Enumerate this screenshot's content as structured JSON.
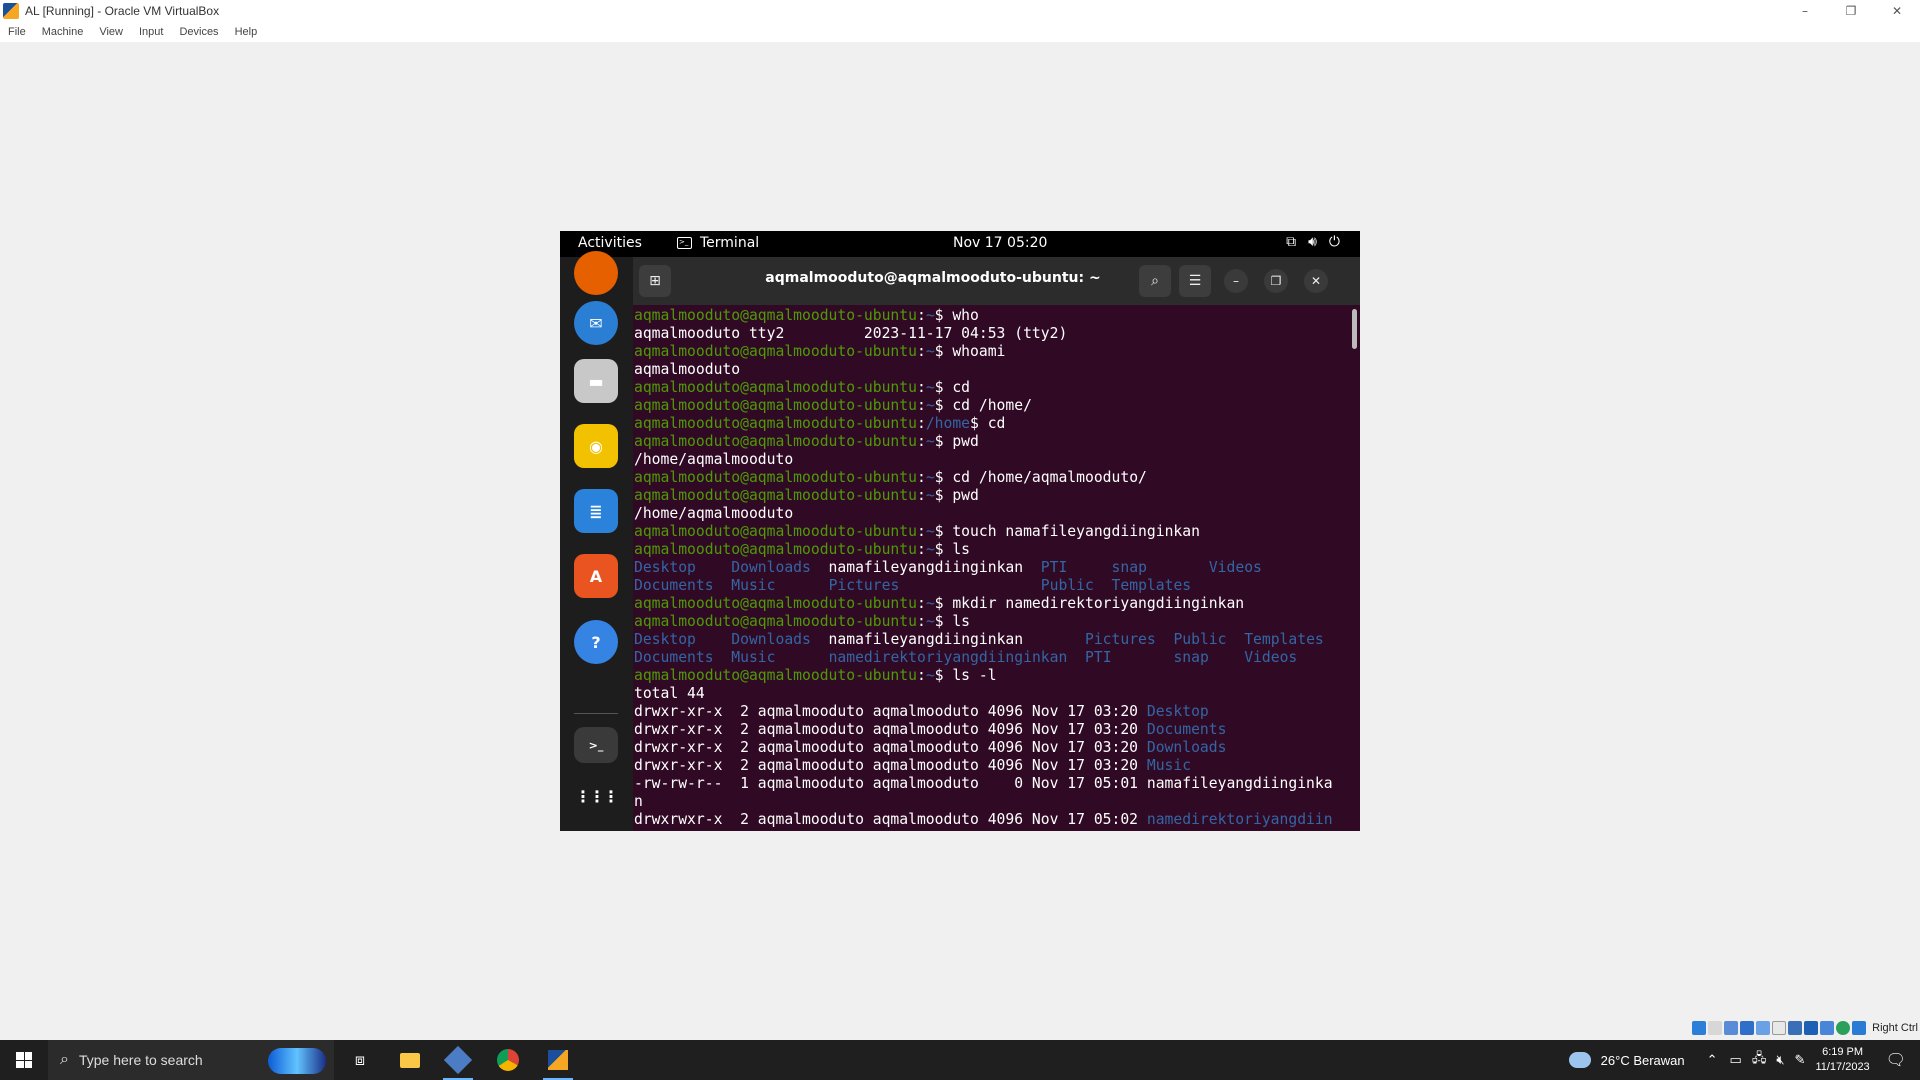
{
  "host": {
    "title": "AL [Running] - Oracle VM VirtualBox",
    "controls": [
      "–",
      "❐",
      "✕"
    ],
    "menu": [
      "File",
      "Machine",
      "View",
      "Input",
      "Devices",
      "Help"
    ]
  },
  "gnome": {
    "activities": "Activities",
    "app_name": "Terminal",
    "clock": "Nov 17  05:20"
  },
  "terminal": {
    "title": "aqmalmooduto@aqmalmooduto-ubuntu: ~",
    "lines": [
      [
        [
          "u",
          "aqmalmooduto@aqmalmooduto-ubuntu"
        ],
        [
          "t",
          ":"
        ],
        [
          "p",
          "~"
        ],
        [
          "t",
          "$ who"
        ]
      ],
      [
        [
          "t",
          "aqmalmooduto tty2         2023-11-17 04:53 (tty2)"
        ]
      ],
      [
        [
          "u",
          "aqmalmooduto@aqmalmooduto-ubuntu"
        ],
        [
          "t",
          ":"
        ],
        [
          "p",
          "~"
        ],
        [
          "t",
          "$ whoami"
        ]
      ],
      [
        [
          "t",
          "aqmalmooduto"
        ]
      ],
      [
        [
          "u",
          "aqmalmooduto@aqmalmooduto-ubuntu"
        ],
        [
          "t",
          ":"
        ],
        [
          "p",
          "~"
        ],
        [
          "t",
          "$ cd"
        ]
      ],
      [
        [
          "u",
          "aqmalmooduto@aqmalmooduto-ubuntu"
        ],
        [
          "t",
          ":"
        ],
        [
          "p",
          "~"
        ],
        [
          "t",
          "$ cd /home/"
        ]
      ],
      [
        [
          "u",
          "aqmalmooduto@aqmalmooduto-ubuntu"
        ],
        [
          "t",
          ":"
        ],
        [
          "p",
          "/home"
        ],
        [
          "t",
          "$ cd"
        ]
      ],
      [
        [
          "u",
          "aqmalmooduto@aqmalmooduto-ubuntu"
        ],
        [
          "t",
          ":"
        ],
        [
          "p",
          "~"
        ],
        [
          "t",
          "$ pwd"
        ]
      ],
      [
        [
          "t",
          "/home/aqmalmooduto"
        ]
      ],
      [
        [
          "u",
          "aqmalmooduto@aqmalmooduto-ubuntu"
        ],
        [
          "t",
          ":"
        ],
        [
          "p",
          "~"
        ],
        [
          "t",
          "$ cd /home/aqmalmooduto/"
        ]
      ],
      [
        [
          "u",
          "aqmalmooduto@aqmalmooduto-ubuntu"
        ],
        [
          "t",
          ":"
        ],
        [
          "p",
          "~"
        ],
        [
          "t",
          "$ pwd"
        ]
      ],
      [
        [
          "t",
          "/home/aqmalmooduto"
        ]
      ],
      [
        [
          "u",
          "aqmalmooduto@aqmalmooduto-ubuntu"
        ],
        [
          "t",
          ":"
        ],
        [
          "p",
          "~"
        ],
        [
          "t",
          "$ touch namafileyangdiinginkan"
        ]
      ],
      [
        [
          "u",
          "aqmalmooduto@aqmalmooduto-ubuntu"
        ],
        [
          "t",
          ":"
        ],
        [
          "p",
          "~"
        ],
        [
          "t",
          "$ ls"
        ]
      ],
      [
        [
          "d",
          "Desktop"
        ],
        [
          "t",
          "    "
        ],
        [
          "d",
          "Downloads"
        ],
        [
          "t",
          "  namafileyangdiinginkan  "
        ],
        [
          "d",
          "PTI"
        ],
        [
          "t",
          "     "
        ],
        [
          "d",
          "snap"
        ],
        [
          "t",
          "       "
        ],
        [
          "d",
          "Videos"
        ]
      ],
      [
        [
          "d",
          "Documents"
        ],
        [
          "t",
          "  "
        ],
        [
          "d",
          "Music"
        ],
        [
          "t",
          "      "
        ],
        [
          "d",
          "Pictures"
        ],
        [
          "t",
          "                "
        ],
        [
          "d",
          "Public"
        ],
        [
          "t",
          "  "
        ],
        [
          "d",
          "Templates"
        ]
      ],
      [
        [
          "u",
          "aqmalmooduto@aqmalmooduto-ubuntu"
        ],
        [
          "t",
          ":"
        ],
        [
          "p",
          "~"
        ],
        [
          "t",
          "$ mkdir namedirektoriyangdiinginkan"
        ]
      ],
      [
        [
          "u",
          "aqmalmooduto@aqmalmooduto-ubuntu"
        ],
        [
          "t",
          ":"
        ],
        [
          "p",
          "~"
        ],
        [
          "t",
          "$ ls"
        ]
      ],
      [
        [
          "d",
          "Desktop"
        ],
        [
          "t",
          "    "
        ],
        [
          "d",
          "Downloads"
        ],
        [
          "t",
          "  namafileyangdiinginkan       "
        ],
        [
          "d",
          "Pictures"
        ],
        [
          "t",
          "  "
        ],
        [
          "d",
          "Public"
        ],
        [
          "t",
          "  "
        ],
        [
          "d",
          "Templates"
        ]
      ],
      [
        [
          "d",
          "Documents"
        ],
        [
          "t",
          "  "
        ],
        [
          "d",
          "Music"
        ],
        [
          "t",
          "      "
        ],
        [
          "d",
          "namedirektoriyangdiinginkan"
        ],
        [
          "t",
          "  "
        ],
        [
          "d",
          "PTI"
        ],
        [
          "t",
          "       "
        ],
        [
          "d",
          "snap"
        ],
        [
          "t",
          "    "
        ],
        [
          "d",
          "Videos"
        ]
      ],
      [
        [
          "u",
          "aqmalmooduto@aqmalmooduto-ubuntu"
        ],
        [
          "t",
          ":"
        ],
        [
          "p",
          "~"
        ],
        [
          "t",
          "$ ls -l"
        ]
      ],
      [
        [
          "t",
          "total 44"
        ]
      ],
      [
        [
          "t",
          "drwxr-xr-x  2 aqmalmooduto aqmalmooduto 4096 Nov 17 03:20 "
        ],
        [
          "d",
          "Desktop"
        ]
      ],
      [
        [
          "t",
          "drwxr-xr-x  2 aqmalmooduto aqmalmooduto 4096 Nov 17 03:20 "
        ],
        [
          "d",
          "Documents"
        ]
      ],
      [
        [
          "t",
          "drwxr-xr-x  2 aqmalmooduto aqmalmooduto 4096 Nov 17 03:20 "
        ],
        [
          "d",
          "Downloads"
        ]
      ],
      [
        [
          "t",
          "drwxr-xr-x  2 aqmalmooduto aqmalmooduto 4096 Nov 17 03:20 "
        ],
        [
          "d",
          "Music"
        ]
      ],
      [
        [
          "t",
          "-rw-rw-r--  1 aqmalmooduto aqmalmooduto    0 Nov 17 05:01 namafileyangdiinginka"
        ]
      ],
      [
        [
          "t",
          "n"
        ]
      ],
      [
        [
          "t",
          "drwxrwxr-x  2 aqmalmooduto aqmalmooduto 4096 Nov 17 05:02 "
        ],
        [
          "d",
          "namedirektoriyangdiin"
        ]
      ]
    ]
  },
  "dock": [
    {
      "name": "firefox-icon",
      "color": "#e66000",
      "glyph": ""
    },
    {
      "name": "thunderbird-icon",
      "color": "#2a7fd4",
      "glyph": "✉"
    },
    {
      "name": "files-icon",
      "color": "#c8c8c8",
      "glyph": "▬"
    },
    {
      "name": "rhythmbox-icon",
      "color": "#f2c200",
      "glyph": "◉"
    },
    {
      "name": "writer-icon",
      "color": "#2a82da",
      "glyph": "≣"
    },
    {
      "name": "software-icon",
      "color": "#e95420",
      "glyph": "A"
    },
    {
      "name": "help-icon",
      "color": "#3584e4",
      "glyph": "?"
    },
    {
      "name": "terminal-icon",
      "color": "#3a3a3a",
      "glyph": ">_"
    },
    {
      "name": "apps-grid-icon",
      "color": "transparent",
      "glyph": "⋮⋮⋮"
    }
  ],
  "vbox_status": {
    "host_key": "Right Ctrl"
  },
  "taskbar": {
    "search_placeholder": "Type here to search",
    "weather": "26°C  Berawan",
    "time": "6:19 PM",
    "date": "11/17/2023"
  },
  "colors": {
    "terminal_bg": "#300a24",
    "prompt_user": "#4e9a06",
    "prompt_path": "#3465a4",
    "directory": "#3465a4"
  }
}
